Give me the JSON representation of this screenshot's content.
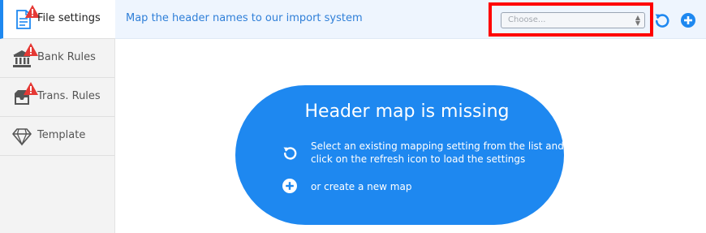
{
  "sidebar": {
    "items": [
      {
        "label": "File settings",
        "icon": "document-icon",
        "warning": true,
        "active": true
      },
      {
        "label": "Bank Rules",
        "icon": "bank-icon",
        "warning": true,
        "active": false
      },
      {
        "label": "Trans. Rules",
        "icon": "inbox-icon",
        "warning": true,
        "active": false
      },
      {
        "label": "Template",
        "icon": "diamond-icon",
        "warning": false,
        "active": false
      }
    ]
  },
  "header": {
    "text": "Map the header names to our import system",
    "select_placeholder": "Choose..."
  },
  "message": {
    "title": "Header map is missing",
    "line1": "Select an existing mapping setting from the list and",
    "line2": "click on the refresh icon to load the settings",
    "line3": "or create a new map"
  },
  "colors": {
    "accent": "#1e88f0",
    "warning": "#e53935",
    "highlight": "#ff0000"
  }
}
